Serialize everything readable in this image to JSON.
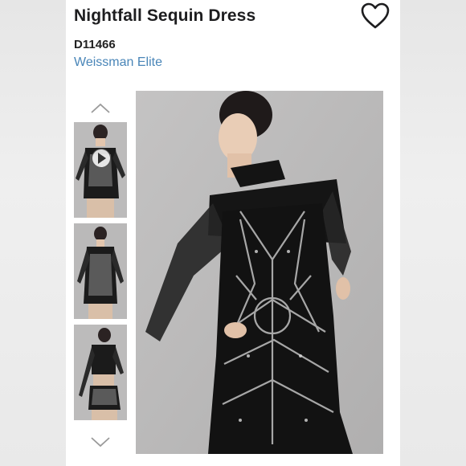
{
  "product": {
    "title": "Nightfall Sequin Dress",
    "sku": "D11466",
    "brand": "Weissman Elite"
  },
  "gallery": {
    "thumbnails": [
      {
        "label": "video-thumbnail",
        "has_play": true
      },
      {
        "label": "front-view-thumbnail",
        "has_play": false
      },
      {
        "label": "two-piece-view-thumbnail",
        "has_play": false
      }
    ]
  },
  "icons": {
    "favorite": "heart-outline-icon",
    "scroll_up": "chevron-up-icon",
    "scroll_down": "chevron-down-icon",
    "play": "play-icon"
  },
  "colors": {
    "brand_link": "#4a86b8",
    "title": "#1d1d1f"
  }
}
